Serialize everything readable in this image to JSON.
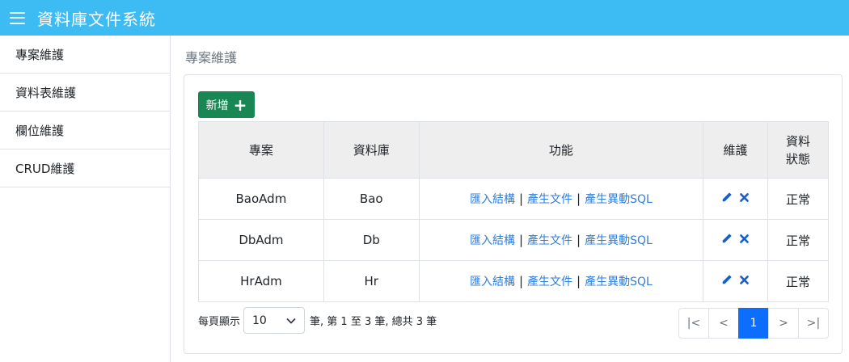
{
  "app": {
    "title": "資料庫文件系統"
  },
  "sidebar": {
    "items": [
      {
        "label": "專案維護"
      },
      {
        "label": "資料表維護"
      },
      {
        "label": "欄位維護"
      },
      {
        "label": "CRUD維護"
      }
    ]
  },
  "main": {
    "page_title": "專案維護",
    "add_button": "新增",
    "table": {
      "headers": [
        "專案",
        "資料庫",
        "功能",
        "維護",
        "資料狀態"
      ],
      "rows": [
        {
          "project": "BaoAdm",
          "db": "Bao",
          "status": "正常"
        },
        {
          "project": "DbAdm",
          "db": "Db",
          "status": "正常"
        },
        {
          "project": "HrAdm",
          "db": "Hr",
          "status": "正常"
        }
      ],
      "func_links": {
        "import": "匯入結構",
        "doc": "產生文件",
        "sql": "產生異動SQL"
      }
    },
    "paging": {
      "per_page_label": "每頁顯示",
      "page_size": "10",
      "summary": "筆, 第 1 至 3 筆, 總共 3 筆",
      "buttons": [
        "|<",
        "<",
        "1",
        ">",
        ">|"
      ]
    }
  },
  "colors": {
    "header": "#3dbbf3",
    "accent": "#198754",
    "link": "#2f7ed8",
    "active_page": "#0d6efd",
    "icon": "#1a5fc9"
  },
  "icons": {
    "menu": "hamburger-icon",
    "add": "plus-icon",
    "edit": "pencil-icon",
    "delete": "close-icon",
    "select": "chevron-down-icon"
  }
}
